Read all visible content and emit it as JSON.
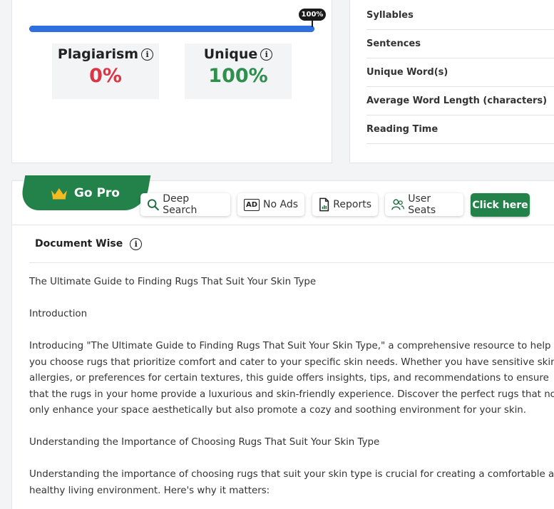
{
  "progress": {
    "badge": "100%",
    "value": 1.0
  },
  "stats": {
    "plagiarism": {
      "label": "Plagiarism",
      "value": "0%"
    },
    "unique": {
      "label": "Unique",
      "value": "100%"
    },
    "info_glyph": "i"
  },
  "metrics": [
    "Syllables",
    "Sentences",
    "Unique Word(s)",
    "Average Word Length (characters)",
    "Reading Time"
  ],
  "pro": {
    "go_pro_label": "Go Pro",
    "features": [
      "Deep Search",
      "No Ads",
      "Reports",
      "User Seats"
    ],
    "ad_icon_text": "AD",
    "click_label": "Click here"
  },
  "document": {
    "title": "Document Wise",
    "paragraphs": [
      "The Ultimate Guide to Finding Rugs That Suit Your Skin Type",
      "Introduction",
      "Introducing \"The Ultimate Guide to Finding Rugs That Suit Your Skin Type,\" a comprehensive resource to help you choose rugs that prioritize comfort and cater to your specific skin needs. Whether you have sensitive skin, allergies, or preferences for certain textures, this guide offers insights, tips, and recommendations to ensure that the rugs in your home provide a luxurious and skin-friendly experience. Discover the perfect rugs that not only enhance your space aesthetically but also promote a cozy and soothing environment for your skin.",
      "Understanding the Importance of Choosing Rugs That Suit Your Skin Type",
      "Understanding the importance of choosing rugs that suit your skin type is crucial for creating a comfortable and healthy living environment. Here's why it matters:"
    ]
  }
}
